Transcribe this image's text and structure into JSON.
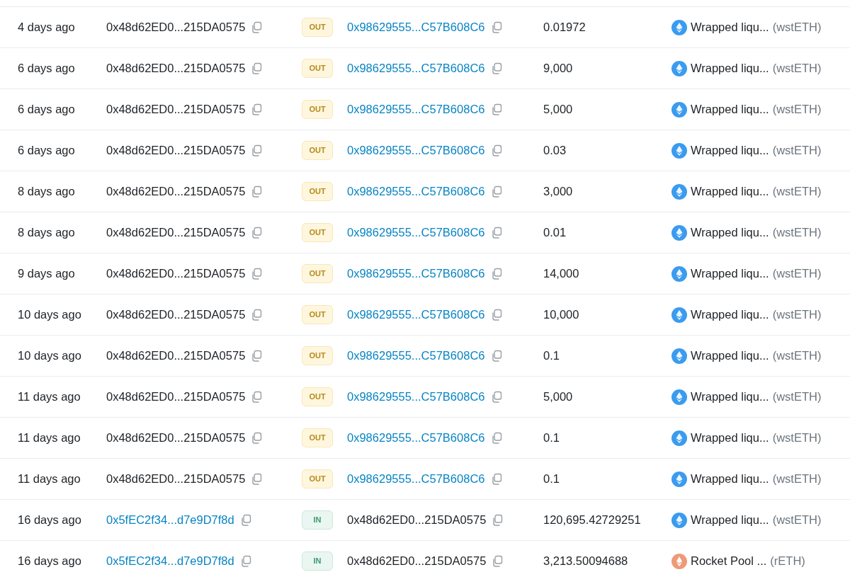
{
  "rows": [
    {
      "age": "4 days ago",
      "from": {
        "address": "0x48d62ED0...215DA0575",
        "linked": false
      },
      "kind": "out",
      "badge": "OUT",
      "to": {
        "address": "0x98629555...C57B608C6",
        "linked": true
      },
      "amount": "0.01972",
      "token": {
        "kind": "wsteth",
        "name": "Wrapped liqu...",
        "symbol": "(wstETH)"
      }
    },
    {
      "age": "6 days ago",
      "from": {
        "address": "0x48d62ED0...215DA0575",
        "linked": false
      },
      "kind": "out",
      "badge": "OUT",
      "to": {
        "address": "0x98629555...C57B608C6",
        "linked": true
      },
      "amount": "9,000",
      "token": {
        "kind": "wsteth",
        "name": "Wrapped liqu...",
        "symbol": "(wstETH)"
      }
    },
    {
      "age": "6 days ago",
      "from": {
        "address": "0x48d62ED0...215DA0575",
        "linked": false
      },
      "kind": "out",
      "badge": "OUT",
      "to": {
        "address": "0x98629555...C57B608C6",
        "linked": true
      },
      "amount": "5,000",
      "token": {
        "kind": "wsteth",
        "name": "Wrapped liqu...",
        "symbol": "(wstETH)"
      }
    },
    {
      "age": "6 days ago",
      "from": {
        "address": "0x48d62ED0...215DA0575",
        "linked": false
      },
      "kind": "out",
      "badge": "OUT",
      "to": {
        "address": "0x98629555...C57B608C6",
        "linked": true
      },
      "amount": "0.03",
      "token": {
        "kind": "wsteth",
        "name": "Wrapped liqu...",
        "symbol": "(wstETH)"
      }
    },
    {
      "age": "8 days ago",
      "from": {
        "address": "0x48d62ED0...215DA0575",
        "linked": false
      },
      "kind": "out",
      "badge": "OUT",
      "to": {
        "address": "0x98629555...C57B608C6",
        "linked": true
      },
      "amount": "3,000",
      "token": {
        "kind": "wsteth",
        "name": "Wrapped liqu...",
        "symbol": "(wstETH)"
      }
    },
    {
      "age": "8 days ago",
      "from": {
        "address": "0x48d62ED0...215DA0575",
        "linked": false
      },
      "kind": "out",
      "badge": "OUT",
      "to": {
        "address": "0x98629555...C57B608C6",
        "linked": true
      },
      "amount": "0.01",
      "token": {
        "kind": "wsteth",
        "name": "Wrapped liqu...",
        "symbol": "(wstETH)"
      }
    },
    {
      "age": "9 days ago",
      "from": {
        "address": "0x48d62ED0...215DA0575",
        "linked": false
      },
      "kind": "out",
      "badge": "OUT",
      "to": {
        "address": "0x98629555...C57B608C6",
        "linked": true
      },
      "amount": "14,000",
      "token": {
        "kind": "wsteth",
        "name": "Wrapped liqu...",
        "symbol": "(wstETH)"
      }
    },
    {
      "age": "10 days ago",
      "from": {
        "address": "0x48d62ED0...215DA0575",
        "linked": false
      },
      "kind": "out",
      "badge": "OUT",
      "to": {
        "address": "0x98629555...C57B608C6",
        "linked": true
      },
      "amount": "10,000",
      "token": {
        "kind": "wsteth",
        "name": "Wrapped liqu...",
        "symbol": "(wstETH)"
      }
    },
    {
      "age": "10 days ago",
      "from": {
        "address": "0x48d62ED0...215DA0575",
        "linked": false
      },
      "kind": "out",
      "badge": "OUT",
      "to": {
        "address": "0x98629555...C57B608C6",
        "linked": true
      },
      "amount": "0.1",
      "token": {
        "kind": "wsteth",
        "name": "Wrapped liqu...",
        "symbol": "(wstETH)"
      }
    },
    {
      "age": "11 days ago",
      "from": {
        "address": "0x48d62ED0...215DA0575",
        "linked": false
      },
      "kind": "out",
      "badge": "OUT",
      "to": {
        "address": "0x98629555...C57B608C6",
        "linked": true
      },
      "amount": "5,000",
      "token": {
        "kind": "wsteth",
        "name": "Wrapped liqu...",
        "symbol": "(wstETH)"
      }
    },
    {
      "age": "11 days ago",
      "from": {
        "address": "0x48d62ED0...215DA0575",
        "linked": false
      },
      "kind": "out",
      "badge": "OUT",
      "to": {
        "address": "0x98629555...C57B608C6",
        "linked": true
      },
      "amount": "0.1",
      "token": {
        "kind": "wsteth",
        "name": "Wrapped liqu...",
        "symbol": "(wstETH)"
      }
    },
    {
      "age": "11 days ago",
      "from": {
        "address": "0x48d62ED0...215DA0575",
        "linked": false
      },
      "kind": "out",
      "badge": "OUT",
      "to": {
        "address": "0x98629555...C57B608C6",
        "linked": true
      },
      "amount": "0.1",
      "token": {
        "kind": "wsteth",
        "name": "Wrapped liqu...",
        "symbol": "(wstETH)"
      }
    },
    {
      "age": "16 days ago",
      "from": {
        "address": "0x5fEC2f34...d7e9D7f8d",
        "linked": true
      },
      "kind": "in",
      "badge": "IN",
      "to": {
        "address": "0x48d62ED0...215DA0575",
        "linked": false
      },
      "amount": "120,695.42729251",
      "token": {
        "kind": "wsteth",
        "name": "Wrapped liqu...",
        "symbol": "(wstETH)"
      }
    },
    {
      "age": "16 days ago",
      "from": {
        "address": "0x5fEC2f34...d7e9D7f8d",
        "linked": true
      },
      "kind": "in",
      "badge": "IN",
      "to": {
        "address": "0x48d62ED0...215DA0575",
        "linked": false
      },
      "amount": "3,213.50094688",
      "token": {
        "kind": "reth",
        "name": "Rocket Pool ...",
        "symbol": "(rETH)"
      }
    }
  ]
}
